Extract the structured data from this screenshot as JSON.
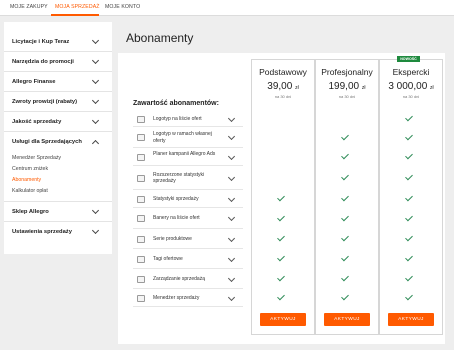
{
  "topnav": {
    "tabs": [
      {
        "label": "MOJE ZAKUPY"
      },
      {
        "label": "MOJA SPRZEDAŻ"
      },
      {
        "label": "MOJE KONTO"
      }
    ]
  },
  "sidebar": {
    "items": [
      {
        "label": "Licytacje i Kup Teraz"
      },
      {
        "label": "Narzędzia do promocji"
      },
      {
        "label": "Allegro Finanse"
      },
      {
        "label": "Zwroty prowizji (rabaty)"
      },
      {
        "label": "Jakość sprzedaży"
      },
      {
        "label": "Usługi dla Sprzedających"
      },
      {
        "label": "Sklep Allegro"
      },
      {
        "label": "Ustawienia sprzedaży"
      }
    ],
    "subitems": [
      {
        "label": "Menedżer Sprzedaży"
      },
      {
        "label": "Centrum zniżek"
      },
      {
        "label": "Abonamenty"
      },
      {
        "label": "Kalkulator opłat"
      }
    ]
  },
  "main": {
    "title": "Abonamenty",
    "features_heading": "Zawartość abonamentów:",
    "badge": "NOWOŚĆ",
    "plans": [
      {
        "name": "Podstawowy",
        "price": "39,00",
        "currency": "zł",
        "period": "na 30 dni",
        "button": "AKTYWUJ"
      },
      {
        "name": "Profesjonalny",
        "price": "199,00",
        "currency": "zł",
        "period": "na 30 dni",
        "button": "AKTYWUJ"
      },
      {
        "name": "Ekspercki",
        "price": "3 000,00",
        "currency": "zł",
        "period": "na 30 dni",
        "button": "AKTYWUJ"
      }
    ],
    "features": [
      {
        "label": "Logotyp na liście ofert",
        "checks": [
          false,
          false,
          true
        ]
      },
      {
        "label": "Logotyp w ramach własnej oferty",
        "checks": [
          false,
          true,
          true
        ]
      },
      {
        "label": "Planer kampanii Allegro Ads",
        "checks": [
          false,
          true,
          true
        ]
      },
      {
        "label": "Rozszerzone statystyki sprzedaży",
        "checks": [
          false,
          true,
          true
        ]
      },
      {
        "label": "Statystyki sprzedaży",
        "checks": [
          true,
          true,
          true
        ]
      },
      {
        "label": "Banery na liście ofert",
        "checks": [
          true,
          true,
          true
        ]
      },
      {
        "label": "Serie produktowe",
        "checks": [
          true,
          true,
          true
        ]
      },
      {
        "label": "Tagi ofertowe",
        "checks": [
          true,
          true,
          true
        ]
      },
      {
        "label": "Zarządzanie sprzedażą",
        "checks": [
          true,
          true,
          true
        ]
      },
      {
        "label": "Menedżer sprzedaży",
        "checks": [
          true,
          true,
          true
        ]
      }
    ]
  },
  "colors": {
    "accent": "#ff5a00",
    "check": "#2e8b57",
    "badge": "#1e8a3e"
  }
}
